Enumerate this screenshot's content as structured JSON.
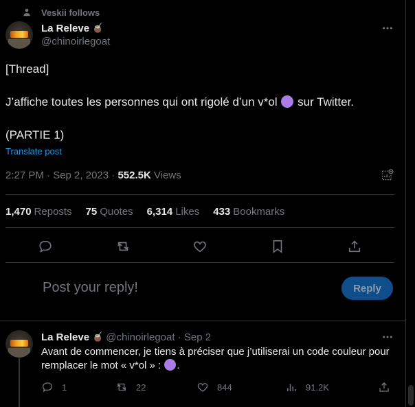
{
  "social_context": "Veskii follows",
  "post": {
    "author_name": "La Releve",
    "author_emoji": "🧉",
    "author_handle": "@chinoirlegoat",
    "line1": "[Thread]",
    "line2_before": "J’affiche toutes les personnes qui ont rigolé d’un v*ol",
    "line2_after": "sur Twitter.",
    "line3": "(PARTIE 1)",
    "translate": "Translate post",
    "timestamp": "2:27 PM · Sep 2, 2023 ·",
    "views_count": "552.5K",
    "views_label": "Views",
    "accent_color": "#1d9bf0",
    "emoji_color": "#aa7ce6"
  },
  "stats": [
    {
      "count": "1,470",
      "label": "Reposts"
    },
    {
      "count": "75",
      "label": "Quotes"
    },
    {
      "count": "6,314",
      "label": "Likes"
    },
    {
      "count": "433",
      "label": "Bookmarks"
    }
  ],
  "actions": [
    "reply-icon",
    "repost-icon",
    "like-icon",
    "bookmark-icon",
    "share-icon"
  ],
  "composer": {
    "placeholder": "Post your reply!",
    "button": "Reply"
  },
  "reply": {
    "author_name": "La Releve",
    "author_emoji": "🧉",
    "meta": "@chinoirlegoat · Sep 2",
    "text_before": "Avant de commencer, je tiens à préciser que j’utiliserai un code couleur pour remplacer le mot « v*ol » :",
    "text_after": ".",
    "reply_count": "1",
    "repost_count": "22",
    "like_count": "844",
    "views_count": "91.2K"
  }
}
